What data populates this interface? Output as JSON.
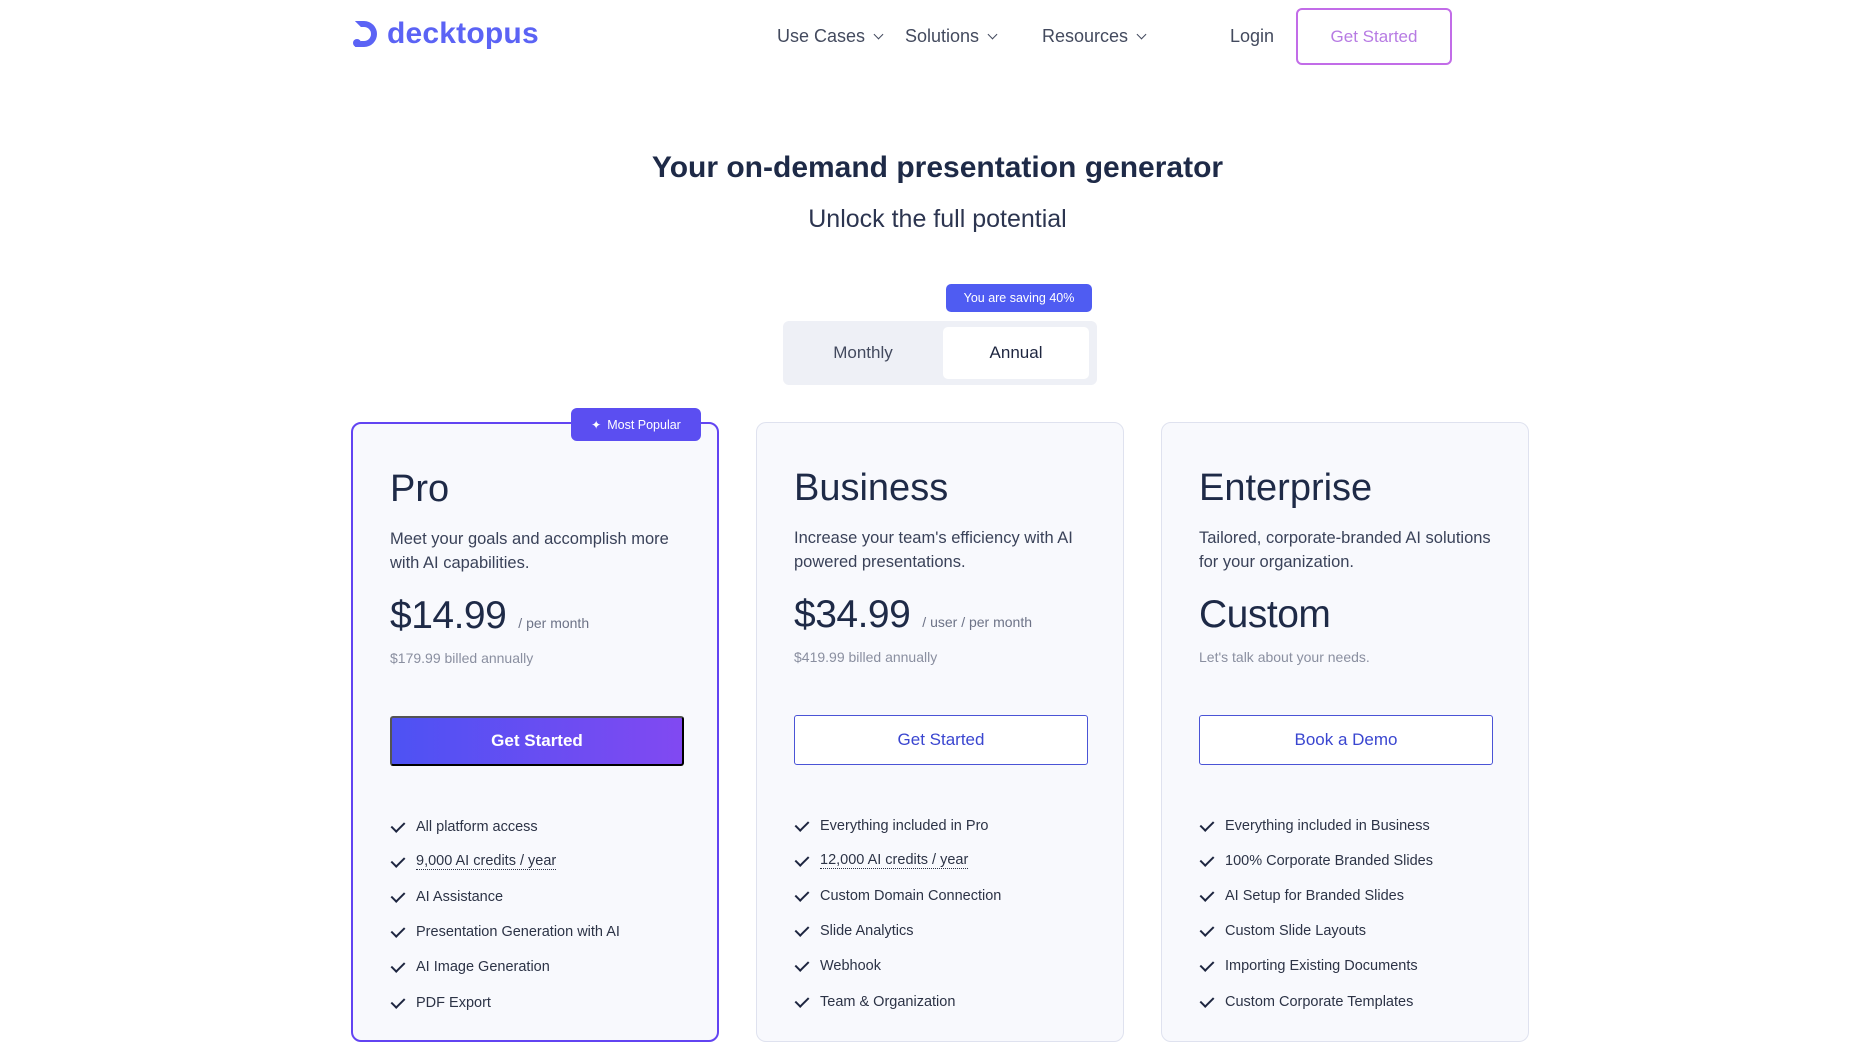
{
  "brand": {
    "name": "decktopus",
    "accent": "#5b63f5"
  },
  "nav": {
    "items": [
      {
        "label": "Use Cases"
      },
      {
        "label": "Solutions"
      },
      {
        "label": "Resources"
      }
    ],
    "login": "Login",
    "get_started": "Get Started"
  },
  "hero": {
    "title": "Your on-demand presentation generator",
    "subtitle": "Unlock the full potential"
  },
  "billing": {
    "saving_badge": "You are saving 40%",
    "monthly": "Monthly",
    "annual": "Annual",
    "selected": "Annual"
  },
  "plans": [
    {
      "badge": "Most Popular",
      "name": "Pro",
      "description": "Meet your goals and accomplish more with AI capabilities.",
      "price": "$14.99",
      "price_unit": "/ per month",
      "billed": "$179.99 billed annually",
      "cta": "Get Started",
      "features": [
        "All platform access",
        "9,000 AI credits / year",
        "AI Assistance",
        "Presentation Generation with AI",
        "AI Image Generation",
        "PDF Export"
      ]
    },
    {
      "name": "Business",
      "description": "Increase your team's efficiency with AI powered presentations.",
      "price": "$34.99",
      "price_unit": "/ user / per month",
      "billed": "$419.99 billed annually",
      "cta": "Get Started",
      "features": [
        "Everything included in Pro",
        "12,000 AI credits / year",
        "Custom Domain Connection",
        "Slide Analytics",
        "Webhook",
        "Team & Organization"
      ]
    },
    {
      "name": "Enterprise",
      "description": "Tailored, corporate-branded AI solutions for your organization.",
      "price": "Custom",
      "billed": "Let's talk about your needs.",
      "cta": "Book a Demo",
      "features": [
        "Everything included in Business",
        "100% Corporate Branded Slides",
        "AI Setup for Branded Slides",
        "Custom Slide Layouts",
        "Importing Existing Documents",
        "Custom Corporate Templates"
      ]
    }
  ]
}
